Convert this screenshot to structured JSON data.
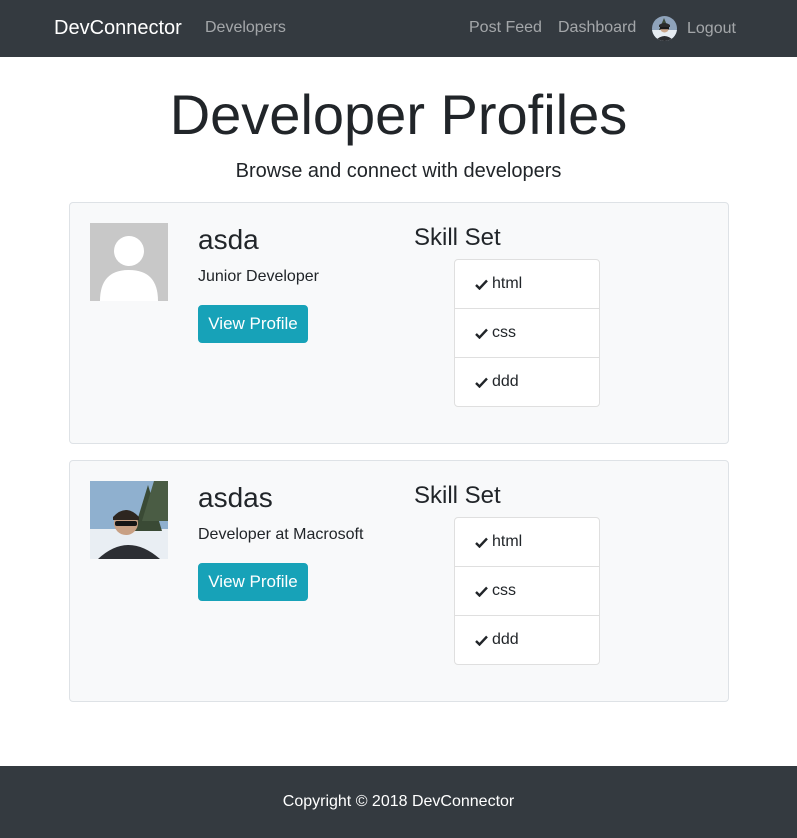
{
  "navbar": {
    "brand": "DevConnector",
    "developers_link": "Developers",
    "post_feed_link": "Post Feed",
    "dashboard_link": "Dashboard",
    "logout_link": "Logout"
  },
  "header": {
    "title": "Developer Profiles",
    "subtitle": "Browse and connect with developers"
  },
  "profiles": [
    {
      "name": "asda",
      "status": "Junior Developer",
      "button_label": "View Profile",
      "skills_heading": "Skill Set",
      "skills": [
        "html",
        "css",
        "ddd"
      ],
      "avatar": "default-avatar-icon"
    },
    {
      "name": "asdas",
      "status": "Developer at Macrosoft",
      "button_label": "View Profile",
      "skills_heading": "Skill Set",
      "skills": [
        "html",
        "css",
        "ddd"
      ],
      "avatar": "user-photo"
    }
  ],
  "footer": {
    "copyright": "Copyright © 2018 DevConnector"
  },
  "colors": {
    "navbar": "#343a40",
    "button": "#17a2b8",
    "card_background": "#f8f9fa"
  }
}
